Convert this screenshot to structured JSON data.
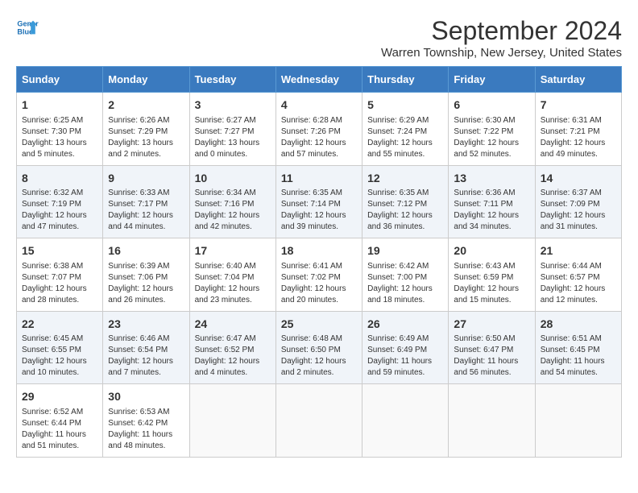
{
  "header": {
    "logo_line1": "General",
    "logo_line2": "Blue",
    "month_title": "September 2024",
    "location": "Warren Township, New Jersey, United States"
  },
  "days_of_week": [
    "Sunday",
    "Monday",
    "Tuesday",
    "Wednesday",
    "Thursday",
    "Friday",
    "Saturday"
  ],
  "weeks": [
    [
      {
        "day": "1",
        "info": "Sunrise: 6:25 AM\nSunset: 7:30 PM\nDaylight: 13 hours\nand 5 minutes."
      },
      {
        "day": "2",
        "info": "Sunrise: 6:26 AM\nSunset: 7:29 PM\nDaylight: 13 hours\nand 2 minutes."
      },
      {
        "day": "3",
        "info": "Sunrise: 6:27 AM\nSunset: 7:27 PM\nDaylight: 13 hours\nand 0 minutes."
      },
      {
        "day": "4",
        "info": "Sunrise: 6:28 AM\nSunset: 7:26 PM\nDaylight: 12 hours\nand 57 minutes."
      },
      {
        "day": "5",
        "info": "Sunrise: 6:29 AM\nSunset: 7:24 PM\nDaylight: 12 hours\nand 55 minutes."
      },
      {
        "day": "6",
        "info": "Sunrise: 6:30 AM\nSunset: 7:22 PM\nDaylight: 12 hours\nand 52 minutes."
      },
      {
        "day": "7",
        "info": "Sunrise: 6:31 AM\nSunset: 7:21 PM\nDaylight: 12 hours\nand 49 minutes."
      }
    ],
    [
      {
        "day": "8",
        "info": "Sunrise: 6:32 AM\nSunset: 7:19 PM\nDaylight: 12 hours\nand 47 minutes."
      },
      {
        "day": "9",
        "info": "Sunrise: 6:33 AM\nSunset: 7:17 PM\nDaylight: 12 hours\nand 44 minutes."
      },
      {
        "day": "10",
        "info": "Sunrise: 6:34 AM\nSunset: 7:16 PM\nDaylight: 12 hours\nand 42 minutes."
      },
      {
        "day": "11",
        "info": "Sunrise: 6:35 AM\nSunset: 7:14 PM\nDaylight: 12 hours\nand 39 minutes."
      },
      {
        "day": "12",
        "info": "Sunrise: 6:35 AM\nSunset: 7:12 PM\nDaylight: 12 hours\nand 36 minutes."
      },
      {
        "day": "13",
        "info": "Sunrise: 6:36 AM\nSunset: 7:11 PM\nDaylight: 12 hours\nand 34 minutes."
      },
      {
        "day": "14",
        "info": "Sunrise: 6:37 AM\nSunset: 7:09 PM\nDaylight: 12 hours\nand 31 minutes."
      }
    ],
    [
      {
        "day": "15",
        "info": "Sunrise: 6:38 AM\nSunset: 7:07 PM\nDaylight: 12 hours\nand 28 minutes."
      },
      {
        "day": "16",
        "info": "Sunrise: 6:39 AM\nSunset: 7:06 PM\nDaylight: 12 hours\nand 26 minutes."
      },
      {
        "day": "17",
        "info": "Sunrise: 6:40 AM\nSunset: 7:04 PM\nDaylight: 12 hours\nand 23 minutes."
      },
      {
        "day": "18",
        "info": "Sunrise: 6:41 AM\nSunset: 7:02 PM\nDaylight: 12 hours\nand 20 minutes."
      },
      {
        "day": "19",
        "info": "Sunrise: 6:42 AM\nSunset: 7:00 PM\nDaylight: 12 hours\nand 18 minutes."
      },
      {
        "day": "20",
        "info": "Sunrise: 6:43 AM\nSunset: 6:59 PM\nDaylight: 12 hours\nand 15 minutes."
      },
      {
        "day": "21",
        "info": "Sunrise: 6:44 AM\nSunset: 6:57 PM\nDaylight: 12 hours\nand 12 minutes."
      }
    ],
    [
      {
        "day": "22",
        "info": "Sunrise: 6:45 AM\nSunset: 6:55 PM\nDaylight: 12 hours\nand 10 minutes."
      },
      {
        "day": "23",
        "info": "Sunrise: 6:46 AM\nSunset: 6:54 PM\nDaylight: 12 hours\nand 7 minutes."
      },
      {
        "day": "24",
        "info": "Sunrise: 6:47 AM\nSunset: 6:52 PM\nDaylight: 12 hours\nand 4 minutes."
      },
      {
        "day": "25",
        "info": "Sunrise: 6:48 AM\nSunset: 6:50 PM\nDaylight: 12 hours\nand 2 minutes."
      },
      {
        "day": "26",
        "info": "Sunrise: 6:49 AM\nSunset: 6:49 PM\nDaylight: 11 hours\nand 59 minutes."
      },
      {
        "day": "27",
        "info": "Sunrise: 6:50 AM\nSunset: 6:47 PM\nDaylight: 11 hours\nand 56 minutes."
      },
      {
        "day": "28",
        "info": "Sunrise: 6:51 AM\nSunset: 6:45 PM\nDaylight: 11 hours\nand 54 minutes."
      }
    ],
    [
      {
        "day": "29",
        "info": "Sunrise: 6:52 AM\nSunset: 6:44 PM\nDaylight: 11 hours\nand 51 minutes."
      },
      {
        "day": "30",
        "info": "Sunrise: 6:53 AM\nSunset: 6:42 PM\nDaylight: 11 hours\nand 48 minutes."
      },
      {
        "day": "",
        "info": ""
      },
      {
        "day": "",
        "info": ""
      },
      {
        "day": "",
        "info": ""
      },
      {
        "day": "",
        "info": ""
      },
      {
        "day": "",
        "info": ""
      }
    ]
  ]
}
